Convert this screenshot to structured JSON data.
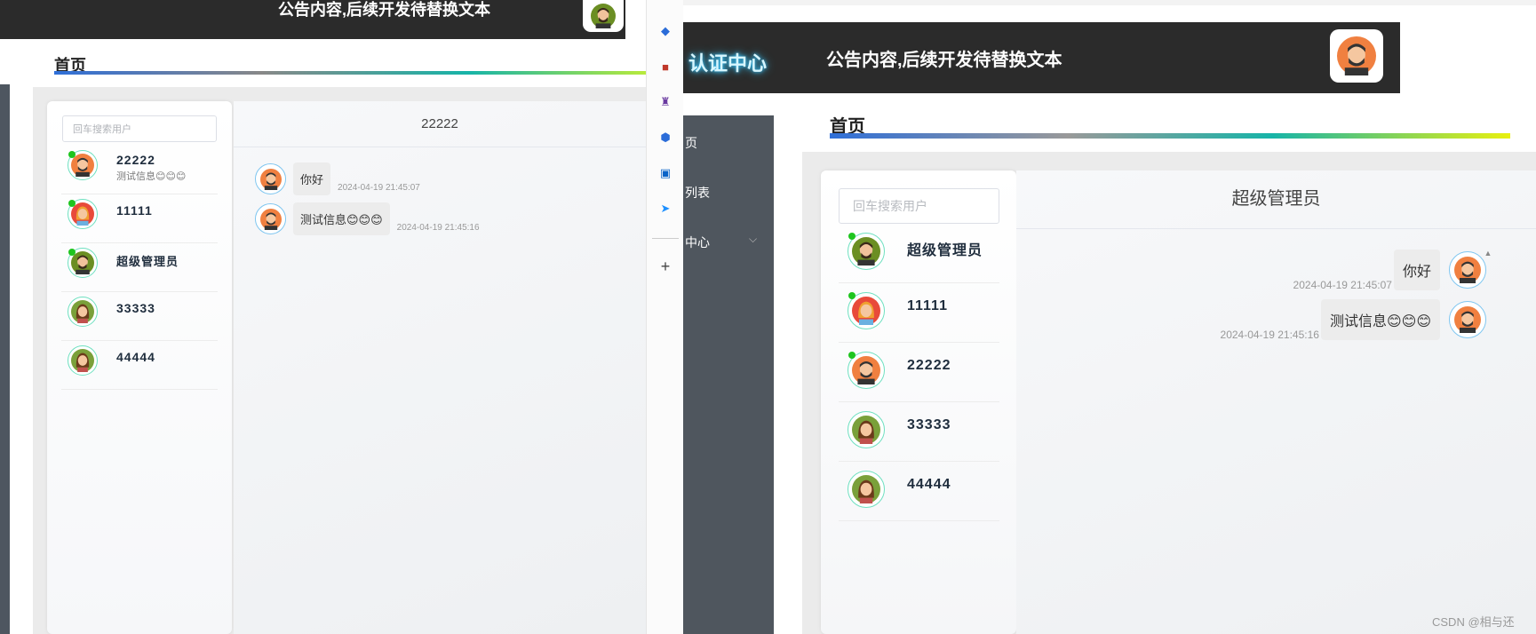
{
  "left_window": {
    "notice": "公告内容,后续开发待替换文本",
    "breadcrumb": "首页",
    "search_placeholder": "回车搜索用户",
    "chat_title": "22222",
    "users": [
      {
        "name": "22222",
        "sub": "测试信息😊😊😊",
        "online": true,
        "avatar": "man-beard-icon"
      },
      {
        "name": "11111",
        "sub": "",
        "online": true,
        "avatar": "woman-red-icon"
      },
      {
        "name": "超级管理员",
        "sub": "",
        "online": true,
        "avatar": "man-green-icon"
      },
      {
        "name": "33333",
        "sub": "",
        "online": false,
        "avatar": "woman-brown-icon"
      },
      {
        "name": "44444",
        "sub": "",
        "online": false,
        "avatar": "woman-brown-icon"
      }
    ],
    "messages": [
      {
        "text": "你好",
        "time": "2024-04-19 21:45:07"
      },
      {
        "text": "测试信息😊😊😊",
        "time": "2024-04-19 21:45:16"
      }
    ]
  },
  "right_window": {
    "app_title": "认证中心",
    "notice": "公告内容,后续开发待替换文本",
    "menu": [
      "页",
      "列表",
      "中心"
    ],
    "breadcrumb": "首页",
    "search_placeholder": "回车搜索用户",
    "chat_title": "超级管理员",
    "users": [
      {
        "name": "超级管理员",
        "online": true,
        "avatar": "man-green-icon"
      },
      {
        "name": "11111",
        "online": true,
        "avatar": "woman-red-icon"
      },
      {
        "name": "22222",
        "online": true,
        "avatar": "man-beard-icon"
      },
      {
        "name": "33333",
        "online": false,
        "avatar": "woman-brown-icon"
      },
      {
        "name": "44444",
        "online": false,
        "avatar": "woman-brown-icon"
      }
    ],
    "messages": [
      {
        "text": "你好",
        "time": "2024-04-19 21:45:07"
      },
      {
        "text": "测试信息😊😊😊",
        "time": "2024-04-19 21:45:16"
      }
    ]
  },
  "watermark": "CSDN @相与还",
  "colors": {
    "banner": "#2b2b2b",
    "online": "#1ec51e",
    "menu": "#4f565e"
  }
}
